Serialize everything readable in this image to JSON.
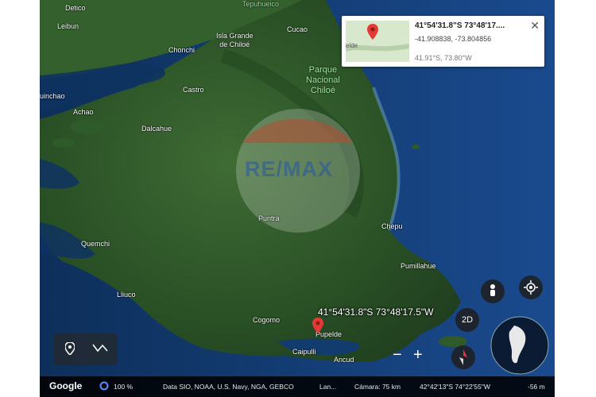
{
  "places": {
    "detico": "Detico",
    "tepuhueico": "Tepuhueico",
    "leibun": "Leibun",
    "cucao": "Cucao",
    "isla_grande": "Isla Grande\nde Chiloé",
    "chonchi": "Chonchi",
    "castro": "Castro",
    "quinchao": "uinchao",
    "achao": "Achao",
    "dalcahue": "Dalcahue",
    "puntra": "Puntra",
    "chepu": "Chepu",
    "quemchi": "Quemchi",
    "pumillahue": "Pumillahue",
    "lliuco": "Lliuco",
    "cogomo": "Cogomo",
    "pupelde": "Pupelde",
    "caipulli": "Caipulli",
    "ancud": "Ancud"
  },
  "park_label": "Parque\nNacional\nChiloé",
  "pin_label": "41°54'31.8\"S 73°48'17.5\"W",
  "info_card": {
    "thumb_label": "elde",
    "coord_dms": "41°54'31.8\"S 73°48'17....",
    "coord_decimal": "-41.908838, -73.804856",
    "coord_short": "41.91°S, 73.80°W",
    "close": "✕"
  },
  "controls": {
    "view_2d": "2D",
    "zoom_out": "−",
    "zoom_in": "+"
  },
  "watermark": "RE/MAX",
  "footer": {
    "brand": "Google",
    "zoom_pct": "100 %",
    "attribution": "Data SIO, NOAA, U.S. Navy, NGA, GEBCO",
    "attribution_more": "Lan...",
    "camera": "Cámara: 75 km",
    "cursor_coord": "42°42'13\"S 74°22'55\"W",
    "elevation": "-56 m"
  },
  "colors": {
    "ocean": "#0a2a52",
    "land": "#2e5a2a",
    "pin": "#e53935"
  }
}
